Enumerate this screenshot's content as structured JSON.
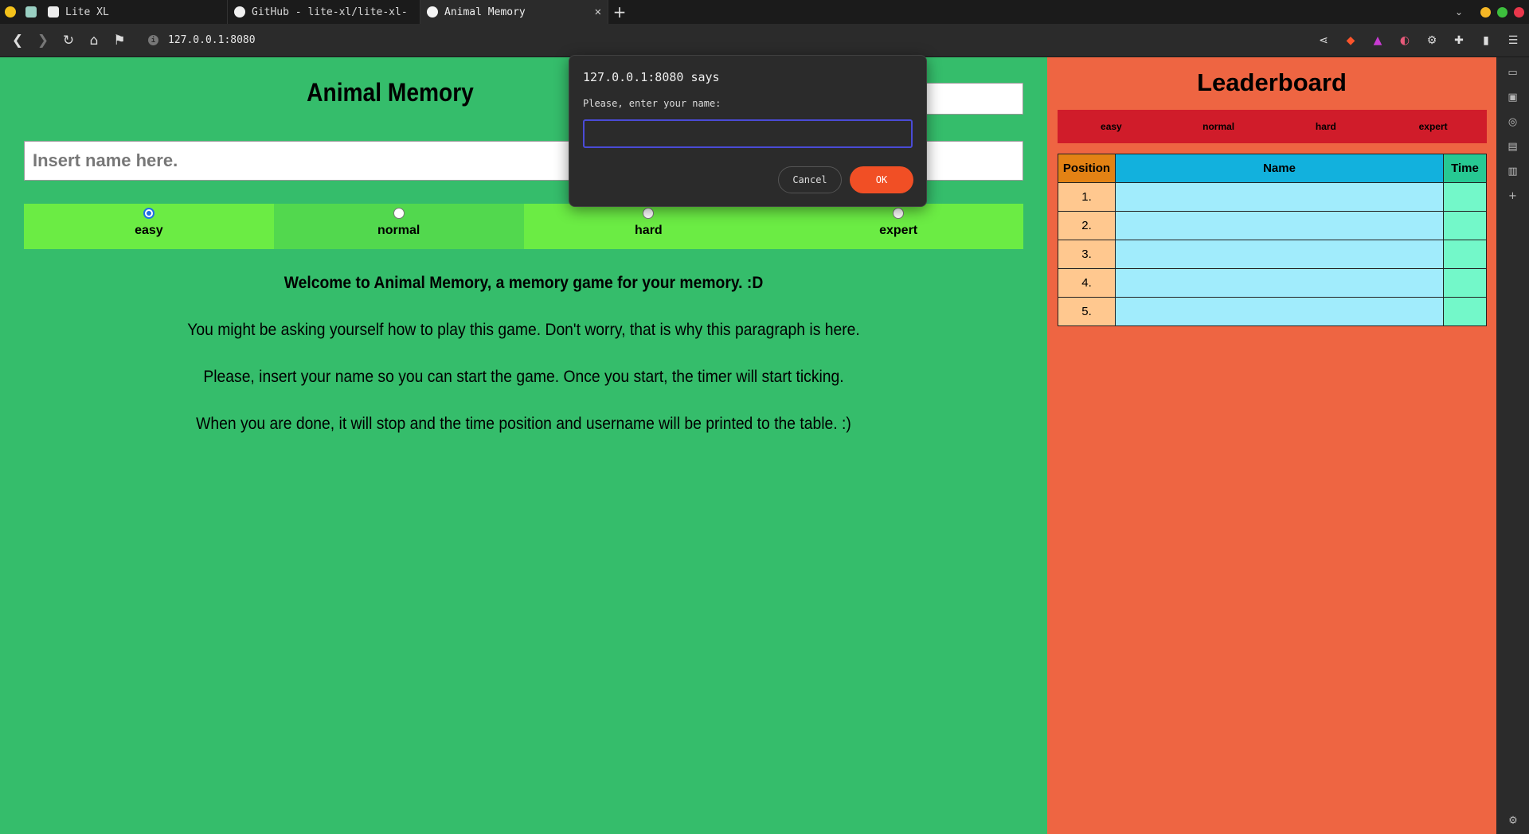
{
  "browser": {
    "tabs": [
      {
        "label": "Lite XL",
        "active": false
      },
      {
        "label": "GitHub - lite-xl/lite-xl-",
        "active": false
      },
      {
        "label": "Animal Memory",
        "active": true
      }
    ],
    "url": "127.0.0.1:8080",
    "window_controls": {
      "minimize": "#f5b625",
      "maximize": "#3dbf3d",
      "close": "#e9374b"
    }
  },
  "game": {
    "title": "Animal Memory",
    "name_placeholder": "Insert name here.",
    "difficulties": [
      {
        "label": "easy",
        "selected": true
      },
      {
        "label": "normal",
        "selected": false
      },
      {
        "label": "hard",
        "selected": false
      },
      {
        "label": "expert",
        "selected": false
      }
    ],
    "welcome": "Welcome to Animal Memory, a memory game for your memory. :D",
    "paragraphs": [
      "You might be asking yourself how to play this game. Don't worry, that is why this paragraph is here.",
      "Please, insert your name so you can start the game. Once you start, the timer will start ticking.",
      "When you are done, it will stop and the time position and username will be printed to the table. :)"
    ]
  },
  "leaderboard": {
    "title": "Leaderboard",
    "tabs": [
      "easy",
      "normal",
      "hard",
      "expert"
    ],
    "headers": {
      "position": "Position",
      "name": "Name",
      "time": "Time"
    },
    "rows": [
      {
        "position": "1.",
        "name": "",
        "time": ""
      },
      {
        "position": "2.",
        "name": "",
        "time": ""
      },
      {
        "position": "3.",
        "name": "",
        "time": ""
      },
      {
        "position": "4.",
        "name": "",
        "time": ""
      },
      {
        "position": "5.",
        "name": "",
        "time": ""
      }
    ]
  },
  "dialog": {
    "title": "127.0.0.1:8080 says",
    "message": "Please, enter your name:",
    "input_value": "",
    "cancel_label": "Cancel",
    "ok_label": "OK"
  },
  "colors": {
    "game_bg": "#35bd6b",
    "board_bg": "#ee6542",
    "ok_button": "#f14f25"
  }
}
